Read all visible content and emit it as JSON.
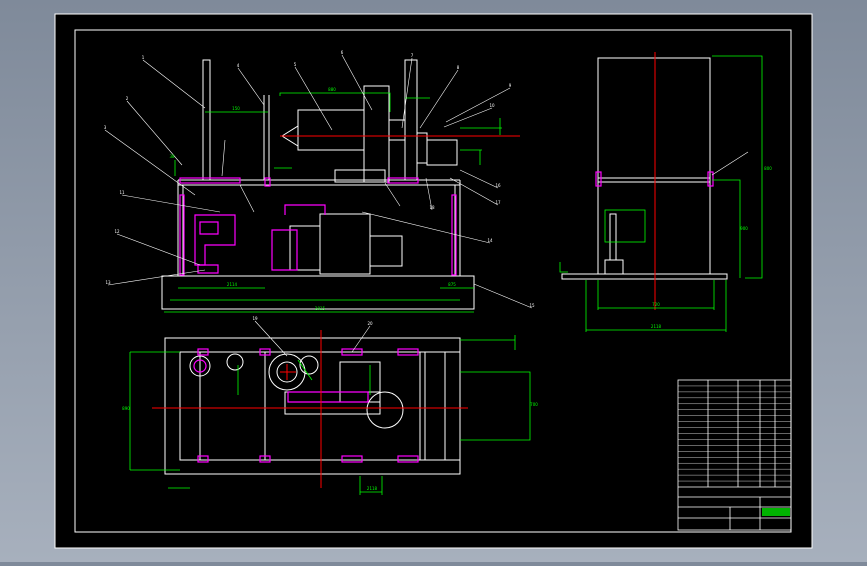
{
  "drawing": {
    "background_color": "#000000",
    "frame_color": "#ffffff",
    "colors": {
      "outline": "#ffffff",
      "dimension": "#00ff00",
      "leader": "#ffffff",
      "part_highlight": "#ff00ff",
      "center_line": "#ff0000"
    }
  },
  "labels": {
    "front_view_dims": [
      "150",
      "880",
      "2114",
      "875",
      "38",
      "2015"
    ],
    "side_view_dims": [
      "800",
      "900",
      "720",
      "2118"
    ],
    "plan_view_dims": [
      "890",
      "700",
      "2118"
    ],
    "balloons": [
      "1",
      "2",
      "3",
      "4",
      "5",
      "6",
      "7",
      "8",
      "9",
      "10",
      "11",
      "12",
      "13",
      "14",
      "15",
      "16",
      "17",
      "18",
      "19",
      "20"
    ]
  },
  "title_block": {
    "rows": 18
  }
}
